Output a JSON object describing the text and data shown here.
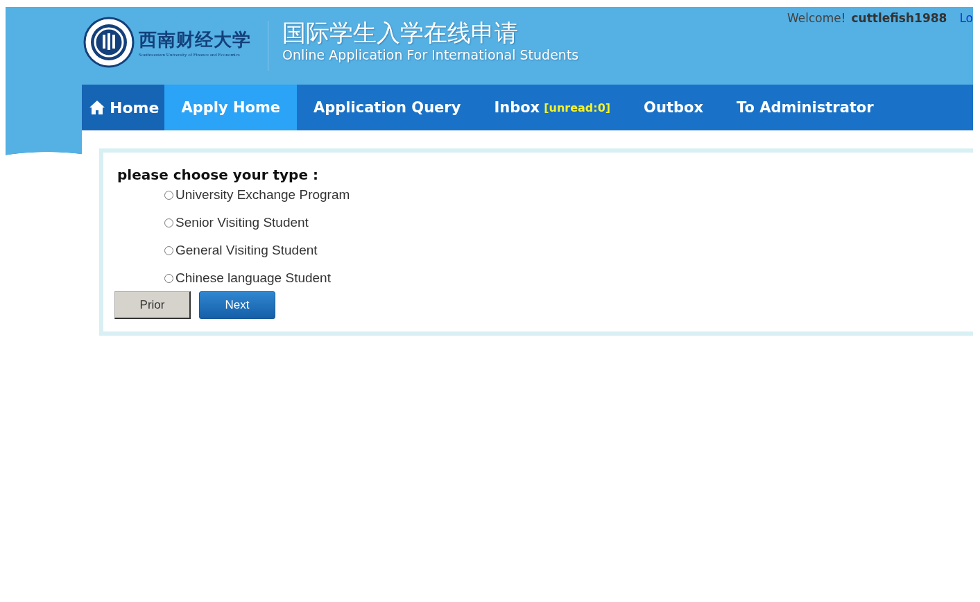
{
  "header": {
    "logo_name": "西南财经大学",
    "logo_subtitle": "Southwestern University of Finance and Economics",
    "title": "国际学生入学在线申请",
    "subtitle": "Online Application For International Students",
    "welcome": "Welcome!",
    "username": "cuttlefish1988",
    "logout_link": "Lo"
  },
  "nav": [
    {
      "kind": "home",
      "label": "Home",
      "selected": false
    },
    {
      "kind": "tab",
      "label": "Apply Home",
      "selected": true
    },
    {
      "kind": "tab",
      "label": "Application Query",
      "selected": false
    },
    {
      "kind": "tab",
      "label": "Inbox",
      "badge": "[unread:0]",
      "selected": false
    },
    {
      "kind": "tab",
      "label": "Outbox",
      "selected": false
    },
    {
      "kind": "tab",
      "label": "To Administrator",
      "selected": false
    }
  ],
  "form": {
    "prompt": "please choose your type :",
    "options": [
      {
        "label": "University Exchange Program",
        "selected": false
      },
      {
        "label": "Senior Visiting Student",
        "selected": false
      },
      {
        "label": "General Visiting Student",
        "selected": false
      },
      {
        "label": "Chinese language Student",
        "selected": false
      }
    ],
    "buttons": [
      {
        "kind": "secondary",
        "label": "Prior"
      },
      {
        "kind": "primary",
        "label": "Next"
      }
    ]
  }
}
